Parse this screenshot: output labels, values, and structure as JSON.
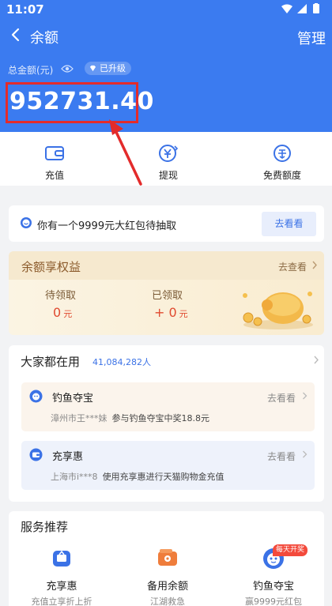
{
  "status_bar": {
    "time": "11:07"
  },
  "header": {
    "title": "余额",
    "manage_label": "管理",
    "total_label": "总金额(元)",
    "upgrade_badge": "已升级",
    "balance": "952731.40"
  },
  "actions": [
    {
      "label": "充值",
      "icon": "wallet-icon"
    },
    {
      "label": "提现",
      "icon": "withdraw-yen-icon"
    },
    {
      "label": "免费额度",
      "icon": "free-quota-icon"
    }
  ],
  "notice": {
    "text": "你有一个9999元大红包待抽取",
    "button": "去看看"
  },
  "rights": {
    "title": "余额享权益",
    "link": "去查看",
    "pending_label": "待领取",
    "pending_value": "0",
    "received_label": "已领取",
    "received_value": "+ 0",
    "unit": "元"
  },
  "popular": {
    "title": "大家都在用",
    "count": "41,084,282人",
    "items": [
      {
        "name": "钓鱼夺宝",
        "go": "去看看",
        "user": "漳州市王***妹",
        "desc": "参与钓鱼夺宝中奖18.8元"
      },
      {
        "name": "充享惠",
        "go": "去看看",
        "user": "上海市i***8",
        "desc": "使用充享惠进行天猫购物金充值"
      }
    ]
  },
  "services": {
    "title": "服务推荐",
    "hot_tag": "每天开奖",
    "items": [
      {
        "name": "充享惠",
        "sub": "充值立享折上折"
      },
      {
        "name": "备用余额",
        "sub": "江湖救急"
      },
      {
        "name": "钓鱼夺宝",
        "sub": "赢9999元红包"
      }
    ]
  },
  "colors": {
    "primary": "#3b7bf0",
    "highlight_box": "#e32b2b",
    "accent_red": "#e04a2f",
    "gold_text": "#8b5a2b"
  }
}
